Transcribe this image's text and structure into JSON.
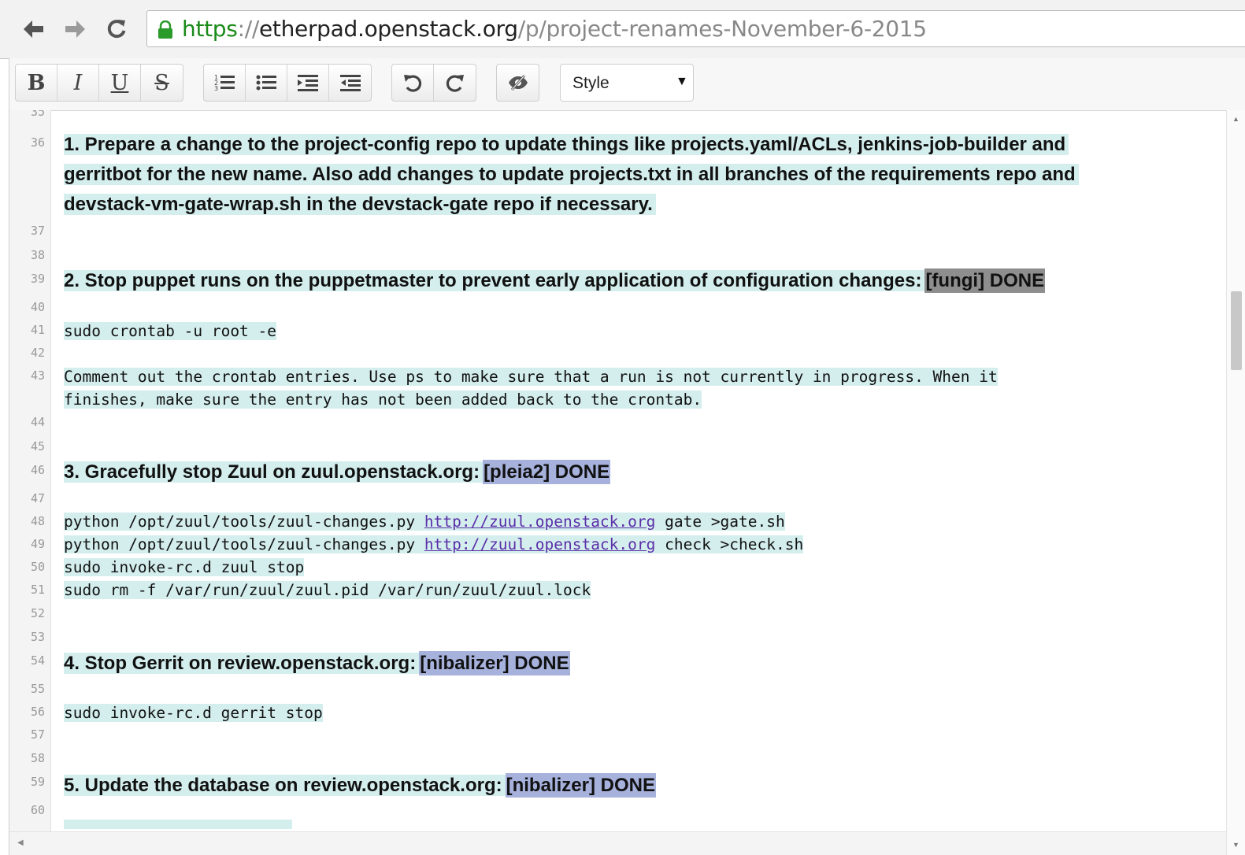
{
  "browser": {
    "url_scheme": "https",
    "url_sep": "://",
    "url_host": "etherpad.openstack.org",
    "url_path": "/p/project-renames-November-6-2015"
  },
  "toolbar": {
    "bold": "B",
    "italic": "I",
    "underline": "U",
    "strike": "S",
    "style_label": "Style"
  },
  "editor": {
    "line_numbers": [
      "35",
      "36",
      "37",
      "38",
      "39",
      "40",
      "41",
      "42",
      "43",
      "44",
      "45",
      "46",
      "47",
      "48",
      "49",
      "50",
      "51",
      "52",
      "53",
      "54",
      "55",
      "56",
      "57",
      "58",
      "59",
      "60"
    ],
    "step1": {
      "l1": "1. Prepare a change to the project-config repo to update things like projects.yaml/ACLs, jenkins-job-builder and",
      "l2": "gerritbot for the new name. Also add changes to update projects.txt in all branches of the requirements repo and",
      "l3": "devstack-vm-gate-wrap.sh in the devstack-gate repo if necessary."
    },
    "step2": {
      "text": "2. Stop puppet runs on the puppetmaster to prevent early application of configuration changes:",
      "tag": "[fungi] DONE",
      "cmd": "sudo crontab -u root -e",
      "note1": "Comment out the crontab entries. Use ps to make sure that a run is not currently in progress. When it",
      "note2": "finishes, make sure the entry has not been added back to the crontab."
    },
    "step3": {
      "text": "3. Gracefully stop Zuul on zuul.openstack.org:",
      "tag": "[pleia2] DONE",
      "cmd1_pre": "python /opt/zuul/tools/zuul-changes.py ",
      "cmd1_link": "http://zuul.openstack.org",
      "cmd1_post": " gate >gate.sh",
      "cmd2_pre": "python /opt/zuul/tools/zuul-changes.py ",
      "cmd2_link": "http://zuul.openstack.org",
      "cmd2_post": " check >check.sh",
      "cmd3": "sudo invoke-rc.d zuul stop",
      "cmd4": "sudo rm -f /var/run/zuul/zuul.pid /var/run/zuul/zuul.lock"
    },
    "step4": {
      "text": "4. Stop Gerrit on review.openstack.org:",
      "tag": "[nibalizer] DONE",
      "cmd": "sudo invoke-rc.d gerrit stop"
    },
    "step5": {
      "text": "5. Update the database on review.openstack.org:",
      "tag": "[nibalizer] DONE"
    }
  },
  "colors": {
    "author_bg": "#d4eded",
    "fungi_bg": "#8e8e8e",
    "pleia2_bg": "#a6b1dc",
    "nibalizer_bg": "#a6b1dc"
  }
}
